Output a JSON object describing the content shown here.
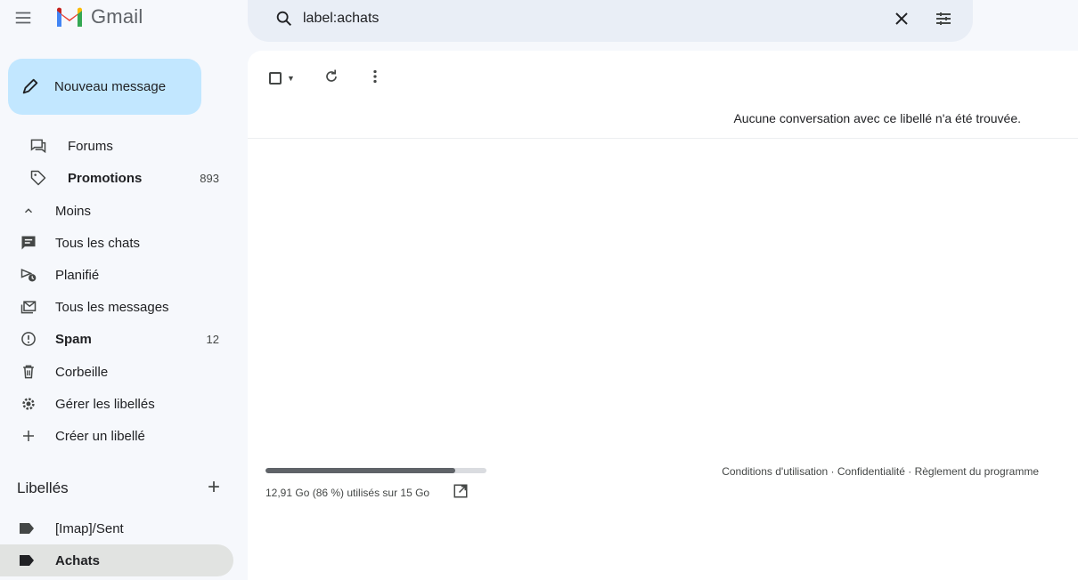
{
  "header": {
    "app_name": "Gmail",
    "search_value": "label:achats"
  },
  "compose": {
    "label": "Nouveau message"
  },
  "nav": {
    "forums": "Forums",
    "promotions": "Promotions",
    "promotions_count": "893",
    "moins": "Moins",
    "chats": "Tous les chats",
    "planifie": "Planifié",
    "all_mail": "Tous les messages",
    "spam": "Spam",
    "spam_count": "12",
    "trash": "Corbeille",
    "manage_labels": "Gérer les libellés",
    "create_label": "Créer un libellé"
  },
  "labels": {
    "header": "Libellés",
    "items": [
      "[Imap]/Sent",
      "Achats"
    ]
  },
  "main": {
    "empty_message": "Aucune conversation avec ce libellé n'a été trouvée.",
    "storage_text": "12,91 Go (86 %) utilisés sur 15 Go",
    "storage_fraction": 0.86,
    "footer": "Conditions d'utilisation · Confidentialité · Règlement du programme"
  },
  "colors": {
    "compose_bg": "#c2e7ff",
    "search_bg": "#e9eef6",
    "page_bg": "#f6f8fc",
    "active_item_bg": "#e1e3e1"
  }
}
